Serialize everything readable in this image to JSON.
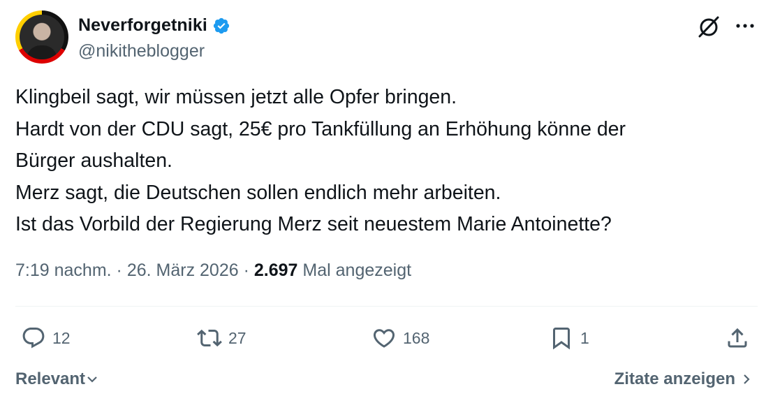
{
  "author": {
    "display_name": "Neverforgetniki",
    "handle": "@nikitheblogger",
    "verified": true,
    "verified_color": "#1d9bf0"
  },
  "tweet": {
    "lines": [
      "Klingbeil sagt, wir müssen jetzt alle Opfer bringen.",
      "Hardt von der CDU sagt, 25€ pro Tankfüllung an Erhöhung könne der",
      "Bürger aushalten.",
      "Merz sagt, die Deutschen sollen endlich mehr arbeiten.",
      "Ist das Vorbild der Regierung Merz seit neuestem Marie Antoinette?"
    ]
  },
  "meta": {
    "time": "7:19 nachm.",
    "date": "26. März 2026",
    "separator": "·",
    "views_count": "2.697",
    "views_label": "Mal angezeigt"
  },
  "actions": {
    "replies": "12",
    "reposts": "27",
    "likes": "168",
    "bookmarks": "1"
  },
  "footer": {
    "sort_label": "Relevant",
    "quotes_label": "Zitate anzeigen"
  },
  "icons": {
    "top_right": [
      "grok-icon",
      "more-icon"
    ],
    "actions": [
      "reply-icon",
      "repost-icon",
      "like-icon",
      "bookmark-icon",
      "share-icon"
    ]
  },
  "colors": {
    "text_primary": "#0f1419",
    "text_secondary": "#536471",
    "divider": "#eff3f4"
  }
}
